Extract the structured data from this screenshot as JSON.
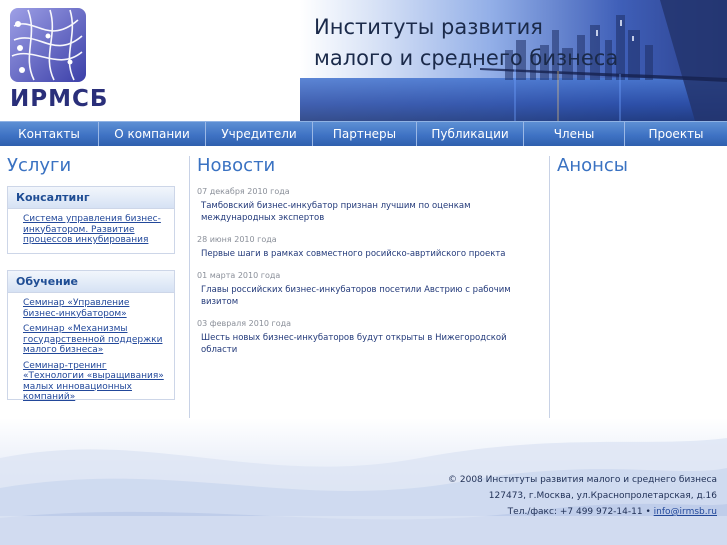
{
  "header": {
    "logo_text": "ИРМСБ",
    "title_line1": "Институты развития",
    "title_line2": "малого и среднего бизнеса"
  },
  "nav": {
    "items": [
      "Контакты",
      "О компании",
      "Учредители",
      "Партнеры",
      "Публикации",
      "Члены",
      "Проекты"
    ]
  },
  "services": {
    "heading": "Услуги",
    "consulting": {
      "title": "Консалтинг",
      "links": [
        "Система управления бизнес-инкубатором. Развитие процессов инкубирования"
      ]
    },
    "training": {
      "title": "Обучение",
      "links": [
        "Семинар «Управление бизнес-инкубатором»",
        "Семинар «Механизмы государственной поддержки малого бизнеса»",
        "Семинар-тренинг «Технологии «выращивания» малых инновационных компаний»"
      ]
    }
  },
  "news": {
    "heading": "Новости",
    "items": [
      {
        "date": "07 декабря 2010 года",
        "text": "Тамбовский бизнес-инкубатор признан лучшим по оценкам международных экспертов"
      },
      {
        "date": "28 июня 2010 года",
        "text": "Первые шаги в рамках совместного росийско-авртийского проекта"
      },
      {
        "date": "01 марта 2010 года",
        "text": "Главы российских бизнес-инкубаторов посетили Австрию с рабочим визитом"
      },
      {
        "date": "03 февраля 2010 года",
        "text": "Шесть новых бизнес-инкубаторов будут открыты в Нижегородской области"
      }
    ]
  },
  "announcements": {
    "heading": "Анонсы"
  },
  "footer": {
    "copyright": "© 2008 Институты развития малого и среднего бизнеса",
    "address": "127473, г.Москва, ул.Краснопролетарская, д.16",
    "phone": "Тел./факс: +7 499 972-14-11 •",
    "email": "info@irmsb.ru"
  },
  "colors": {
    "accent": "#3a72c2",
    "nav": "#3f73c4",
    "link": "#22489a"
  }
}
